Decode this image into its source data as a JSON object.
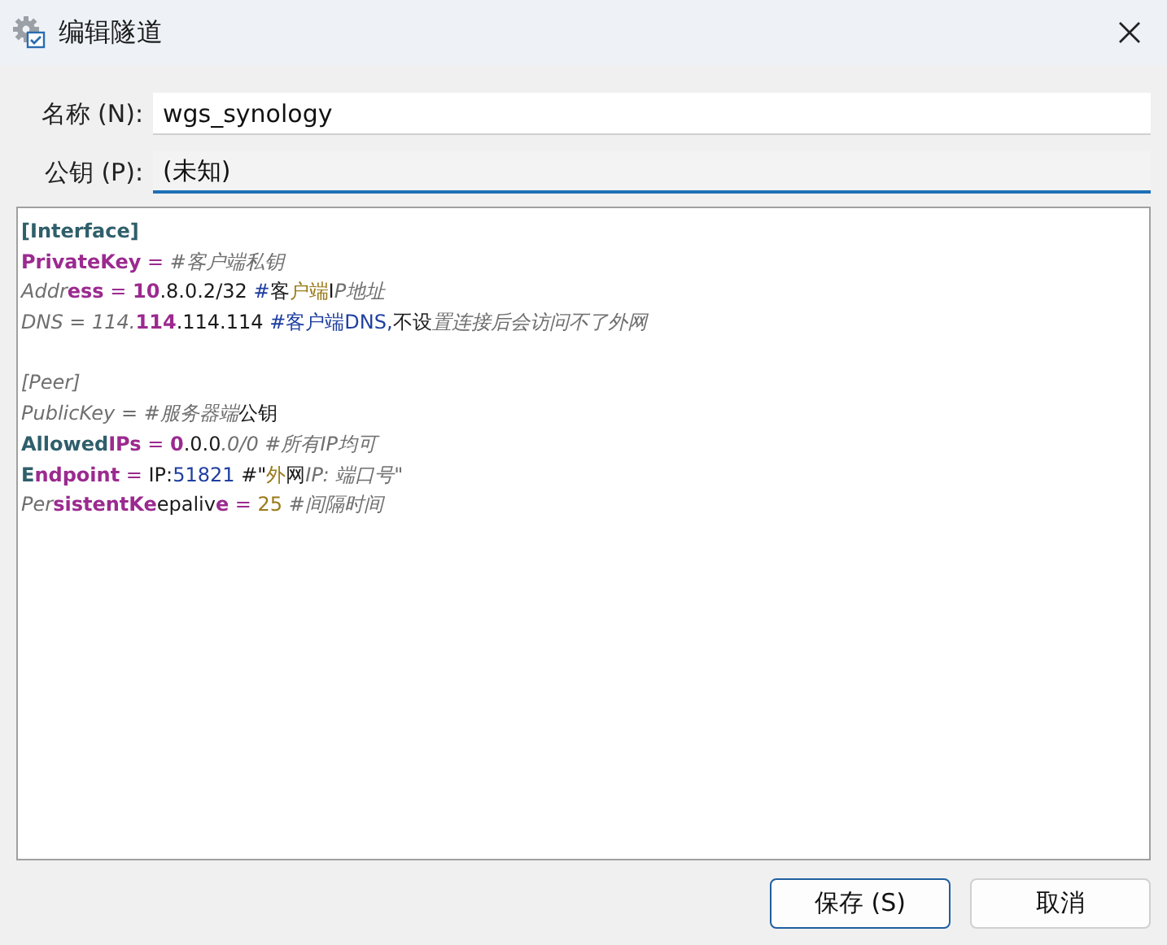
{
  "window": {
    "title": "编辑隧道"
  },
  "fields": [
    {
      "label": "名称 (N):",
      "value": "wgs_synology",
      "readonly": false
    },
    {
      "label": "公钥 (P):",
      "value": "(未知)",
      "readonly": true
    }
  ],
  "editor": {
    "lines": [
      {
        "kind": "code",
        "segments": [
          {
            "kind": "section",
            "text": "[Interface]"
          }
        ]
      },
      {
        "kind": "code",
        "segments": [
          {
            "kind": "key",
            "text": "PrivateKey"
          },
          {
            "kind": "op",
            "text": " = "
          },
          {
            "kind": "comment",
            "text": "#客户端私钥"
          }
        ]
      },
      {
        "kind": "code",
        "segments": [
          {
            "kind": "comment",
            "text": "Addr"
          },
          {
            "kind": "key",
            "text": "ess"
          },
          {
            "kind": "op",
            "text": " = "
          },
          {
            "kind": "key",
            "text": "10"
          },
          {
            "kind": "plain",
            "text": ".8.0.2/32 "
          },
          {
            "kind": "blue",
            "text": "#"
          },
          {
            "kind": "plain",
            "text": "客"
          },
          {
            "kind": "warm",
            "text": "户端"
          },
          {
            "kind": "plain",
            "text": "I"
          },
          {
            "kind": "comment",
            "text": "P地址"
          }
        ]
      },
      {
        "kind": "code",
        "segments": [
          {
            "kind": "comment",
            "text": "DNS = 114."
          },
          {
            "kind": "key",
            "text": "114"
          },
          {
            "kind": "plain",
            "text": ".114.114 "
          },
          {
            "kind": "blue",
            "text": "#客户端DNS,"
          },
          {
            "kind": "plain",
            "text": "不设"
          },
          {
            "kind": "comment",
            "text": "置连接后会访问不了外网"
          }
        ]
      },
      {
        "kind": "blank"
      },
      {
        "kind": "code",
        "segments": [
          {
            "kind": "comment",
            "text": "[Peer]"
          }
        ]
      },
      {
        "kind": "code",
        "segments": [
          {
            "kind": "comment",
            "text": "PublicKey = #服务器端"
          },
          {
            "kind": "plain",
            "text": "公钥"
          }
        ]
      },
      {
        "kind": "code",
        "segments": [
          {
            "kind": "section",
            "text": "Allowed"
          },
          {
            "kind": "key",
            "text": "IPs"
          },
          {
            "kind": "op",
            "text": " = "
          },
          {
            "kind": "key",
            "text": "0"
          },
          {
            "kind": "plain",
            "text": ".0.0"
          },
          {
            "kind": "comment",
            "text": ".0/0 #所有IP均可"
          }
        ]
      },
      {
        "kind": "code",
        "segments": [
          {
            "kind": "section",
            "text": "E"
          },
          {
            "kind": "key",
            "text": "ndpoint"
          },
          {
            "kind": "op",
            "text": " = "
          },
          {
            "kind": "plain",
            "text": "IP:"
          },
          {
            "kind": "blue",
            "text": "51821"
          },
          {
            "kind": "plain",
            "text": " #\""
          },
          {
            "kind": "warm",
            "text": "外"
          },
          {
            "kind": "plain",
            "text": "网"
          },
          {
            "kind": "comment",
            "text": "IP: 端口号\""
          }
        ]
      },
      {
        "kind": "code",
        "segments": [
          {
            "kind": "comment",
            "text": "Per"
          },
          {
            "kind": "key",
            "text": "sistentKe"
          },
          {
            "kind": "plain",
            "text": "epaliv"
          },
          {
            "kind": "key",
            "text": "e"
          },
          {
            "kind": "op",
            "text": " = "
          },
          {
            "kind": "warm",
            "text": "25 "
          },
          {
            "kind": "comment",
            "text": "#间隔时间"
          }
        ]
      }
    ]
  },
  "buttons": [
    {
      "label": "保存 (S)",
      "default": true
    },
    {
      "label": "取消",
      "default": false
    }
  ]
}
